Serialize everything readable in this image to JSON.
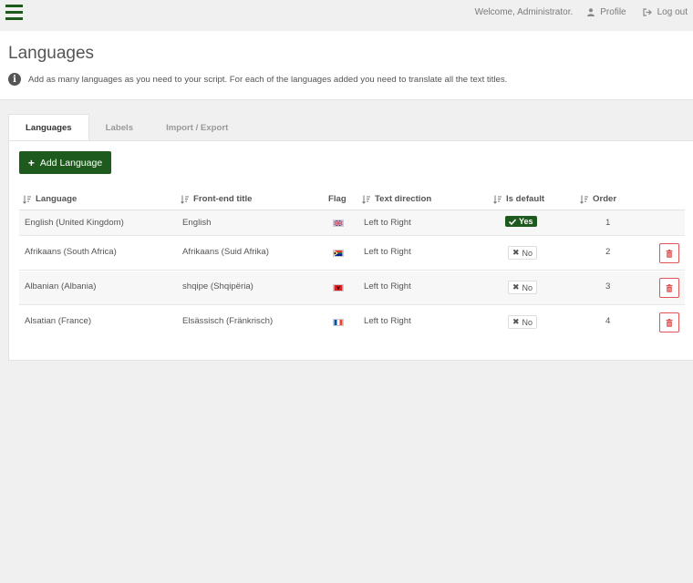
{
  "topbar": {
    "welcome": "Welcome, Administrator.",
    "profile_label": "Profile",
    "logout_label": "Log out"
  },
  "header": {
    "title": "Languages",
    "info_text": "Add as many languages as you need to your script. For each of the languages added you need to translate all the text titles."
  },
  "tabs": [
    {
      "label": "Languages",
      "active": true
    },
    {
      "label": "Labels",
      "active": false
    },
    {
      "label": "Import / Export",
      "active": false
    }
  ],
  "toolbar": {
    "add_label": "Add Language"
  },
  "table": {
    "columns": {
      "language": "Language",
      "frontend": "Front-end title",
      "flag": "Flag",
      "direction": "Text direction",
      "is_default": "Is default",
      "order": "Order"
    },
    "rows": [
      {
        "language": "English (United Kingdom)",
        "frontend": "English",
        "flag": "uk-flag",
        "direction": "Left to Right",
        "is_default": "Yes",
        "order": "1"
      },
      {
        "language": "Afrikaans (South Africa)",
        "frontend": "Afrikaans (Suid Afrika)",
        "flag": "south-africa-flag",
        "direction": "Left to Right",
        "is_default": "No",
        "order": "2"
      },
      {
        "language": "Albanian (Albania)",
        "frontend": "shqipe (Shqipëria)",
        "flag": "albania-flag",
        "direction": "Left to Right",
        "is_default": "No",
        "order": "3"
      },
      {
        "language": "Alsatian (France)",
        "frontend": "Elsässisch (Fränkrisch)",
        "flag": "france-flag",
        "direction": "Left to Right",
        "is_default": "No",
        "order": "4"
      }
    ]
  },
  "colors": {
    "brand": "#1e5a1e",
    "danger": "#e05555",
    "background": "#f0f0f0"
  }
}
